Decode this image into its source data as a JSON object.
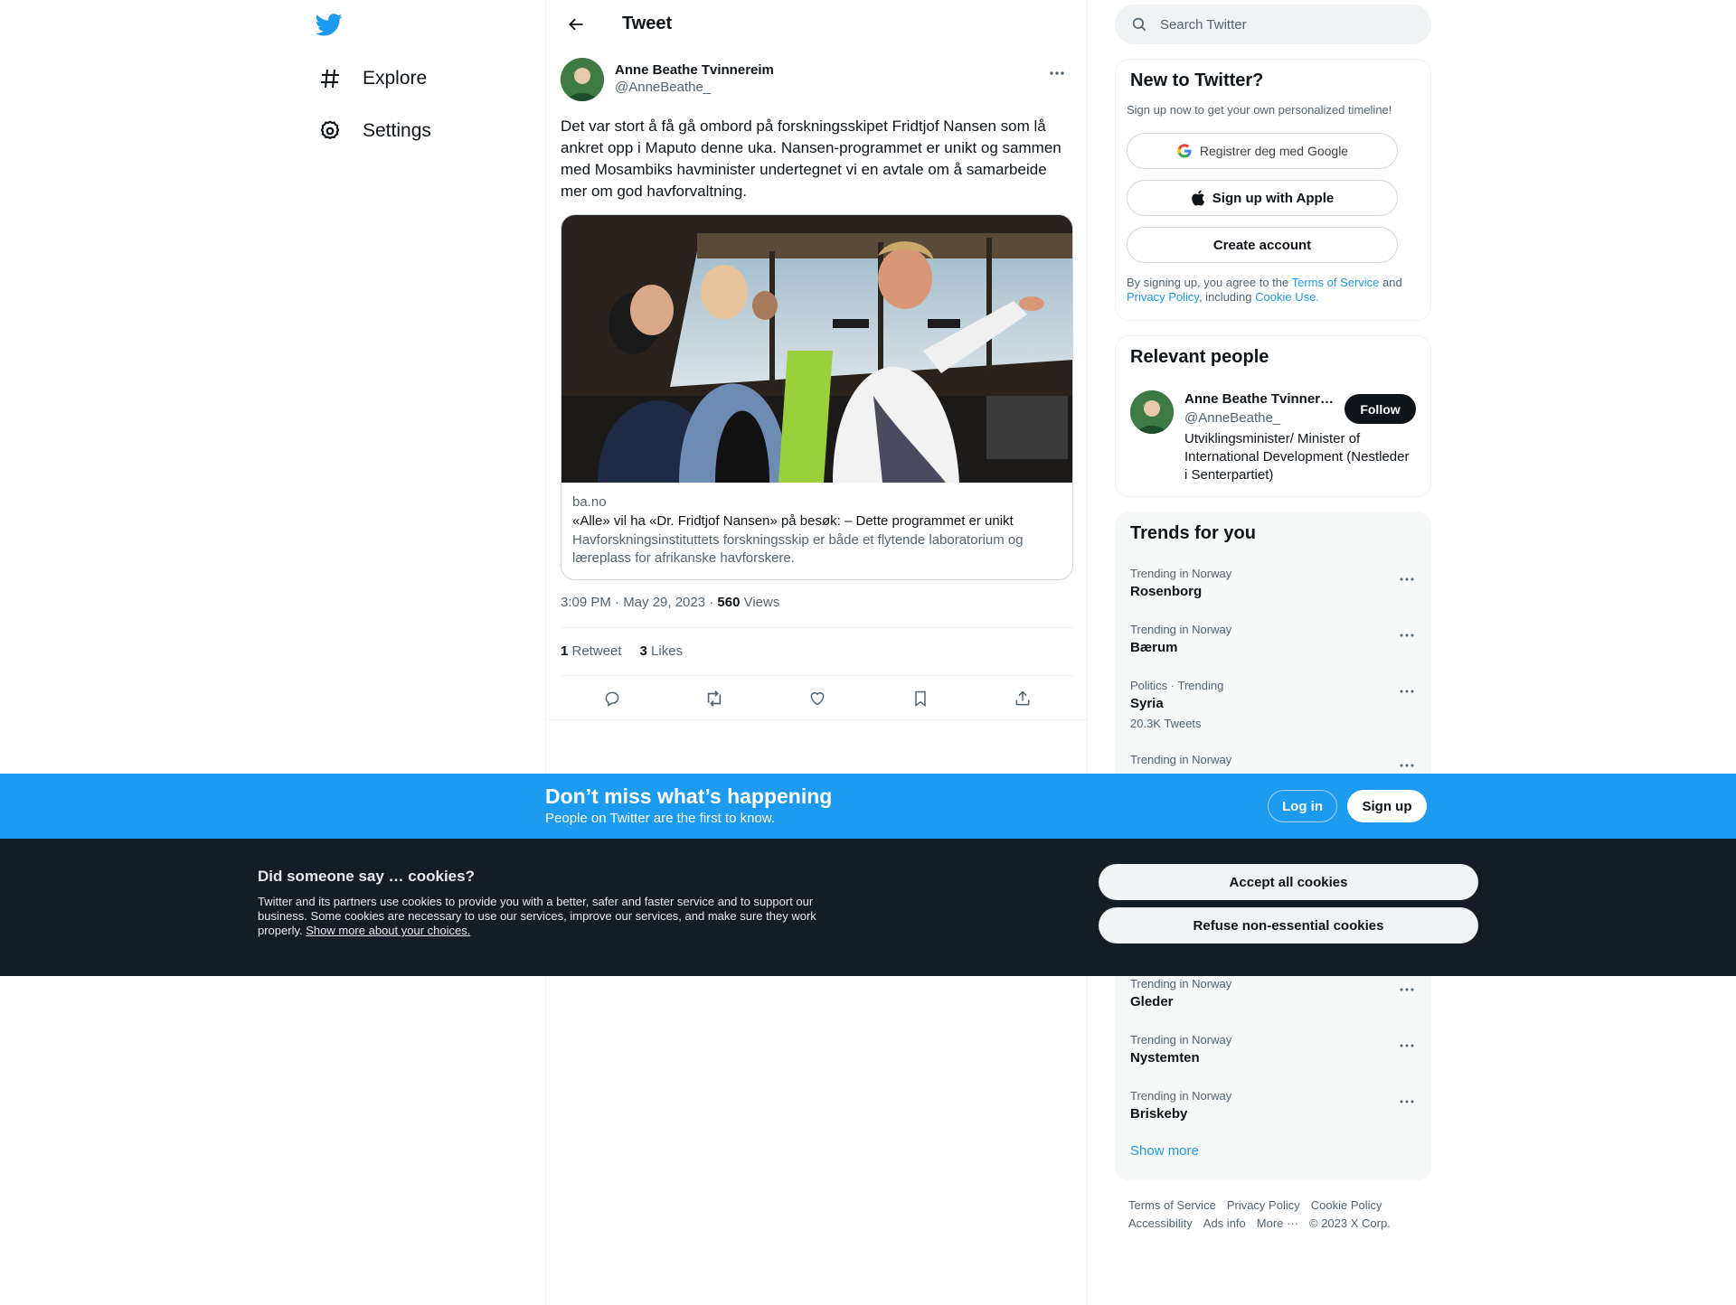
{
  "nav": {
    "logo": "twitter-bird-icon",
    "items": [
      {
        "label": "Explore",
        "icon": "hashtag-icon"
      },
      {
        "label": "Settings",
        "icon": "gear-icon"
      }
    ]
  },
  "header": {
    "title": "Tweet"
  },
  "tweet": {
    "author_name": "Anne Beathe Tvinnereim",
    "author_handle": "@AnneBeathe_",
    "text": "Det var stort å få gå ombord på forskningsskipet Fridtjof Nansen som lå ankret opp i Maputo denne uka. Nansen-programmet er unikt og sammen med Mosambiks havminister undertegnet vi en avtale om å samarbeide mer om god havforvaltning.",
    "card": {
      "domain": "ba.no",
      "title": "«Alle» vil ha «Dr. Fridtjof Nansen» på besøk: – Dette programmet er unikt",
      "description": "Havforskningsinstituttets forskningsskip er både et flytende laboratorium og læreplass for afrikanske havforskere."
    },
    "timestamp": "3:09 PM · May 29, 2023 · ",
    "views_count": "560",
    "views_label": " Views",
    "retweets_count": "1",
    "retweets_label": " Retweet",
    "likes_count": "3",
    "likes_label": " Likes"
  },
  "sidebar": {
    "search_placeholder": "Search Twitter",
    "new_to_twitter": {
      "title": "New to Twitter?",
      "subtitle": "Sign up now to get your own personalized timeline!",
      "google_label": "Registrer deg med Google",
      "apple_label": "Sign up with Apple",
      "create_label": "Create account",
      "legal_prefix": "By signing up, you agree to the ",
      "terms": "Terms of Service",
      "and": " and ",
      "privacy": "Privacy Policy",
      "including": ", including ",
      "cookie_use": "Cookie Use."
    },
    "relevant_people": {
      "title": "Relevant people",
      "name": "Anne Beathe Tvinnereim",
      "handle": "@AnneBeathe_",
      "follow_label": "Follow",
      "bio": "Utviklingsminister/ Minister of International Development (Nestleder i Senterpartiet)"
    },
    "trends": {
      "title": "Trends for you",
      "items": [
        {
          "category": "Trending in Norway",
          "name": "Rosenborg",
          "count": ""
        },
        {
          "category": "Trending in Norway",
          "name": "Bærum",
          "count": ""
        },
        {
          "category": "Politics · Trending",
          "name": "Syria",
          "count": "20.3K Tweets"
        },
        {
          "category": "Trending in Norway",
          "name": "",
          "count": ""
        },
        {
          "category": "Trending in Norway",
          "name": "Gleder",
          "count": ""
        },
        {
          "category": "Trending in Norway",
          "name": "Nystemten",
          "count": ""
        },
        {
          "category": "Trending in Norway",
          "name": "Briskeby",
          "count": ""
        }
      ],
      "show_more": "Show more"
    },
    "footer": {
      "links": [
        "Terms of Service",
        "Privacy Policy",
        "Cookie Policy",
        "Accessibility",
        "Ads info",
        "More ···",
        "© 2023 X Corp."
      ]
    }
  },
  "banner": {
    "title": "Don’t miss what’s happening",
    "subtitle": "People on Twitter are the first to know.",
    "login_label": "Log in",
    "signup_label": "Sign up"
  },
  "cookies": {
    "title": "Did someone say … cookies?",
    "text": "Twitter and its partners use cookies to provide you with a better, safer and faster service and to support our business. Some cookies are necessary to use our services, improve our services, and make sure they work properly. ",
    "link": "Show more about your choices.",
    "accept_label": "Accept all cookies",
    "refuse_label": "Refuse non-essential cookies"
  },
  "colors": {
    "brand": "#1d9bf0",
    "text": "#0f1419",
    "muted": "#536471",
    "cookie_bg": "#141d26"
  }
}
